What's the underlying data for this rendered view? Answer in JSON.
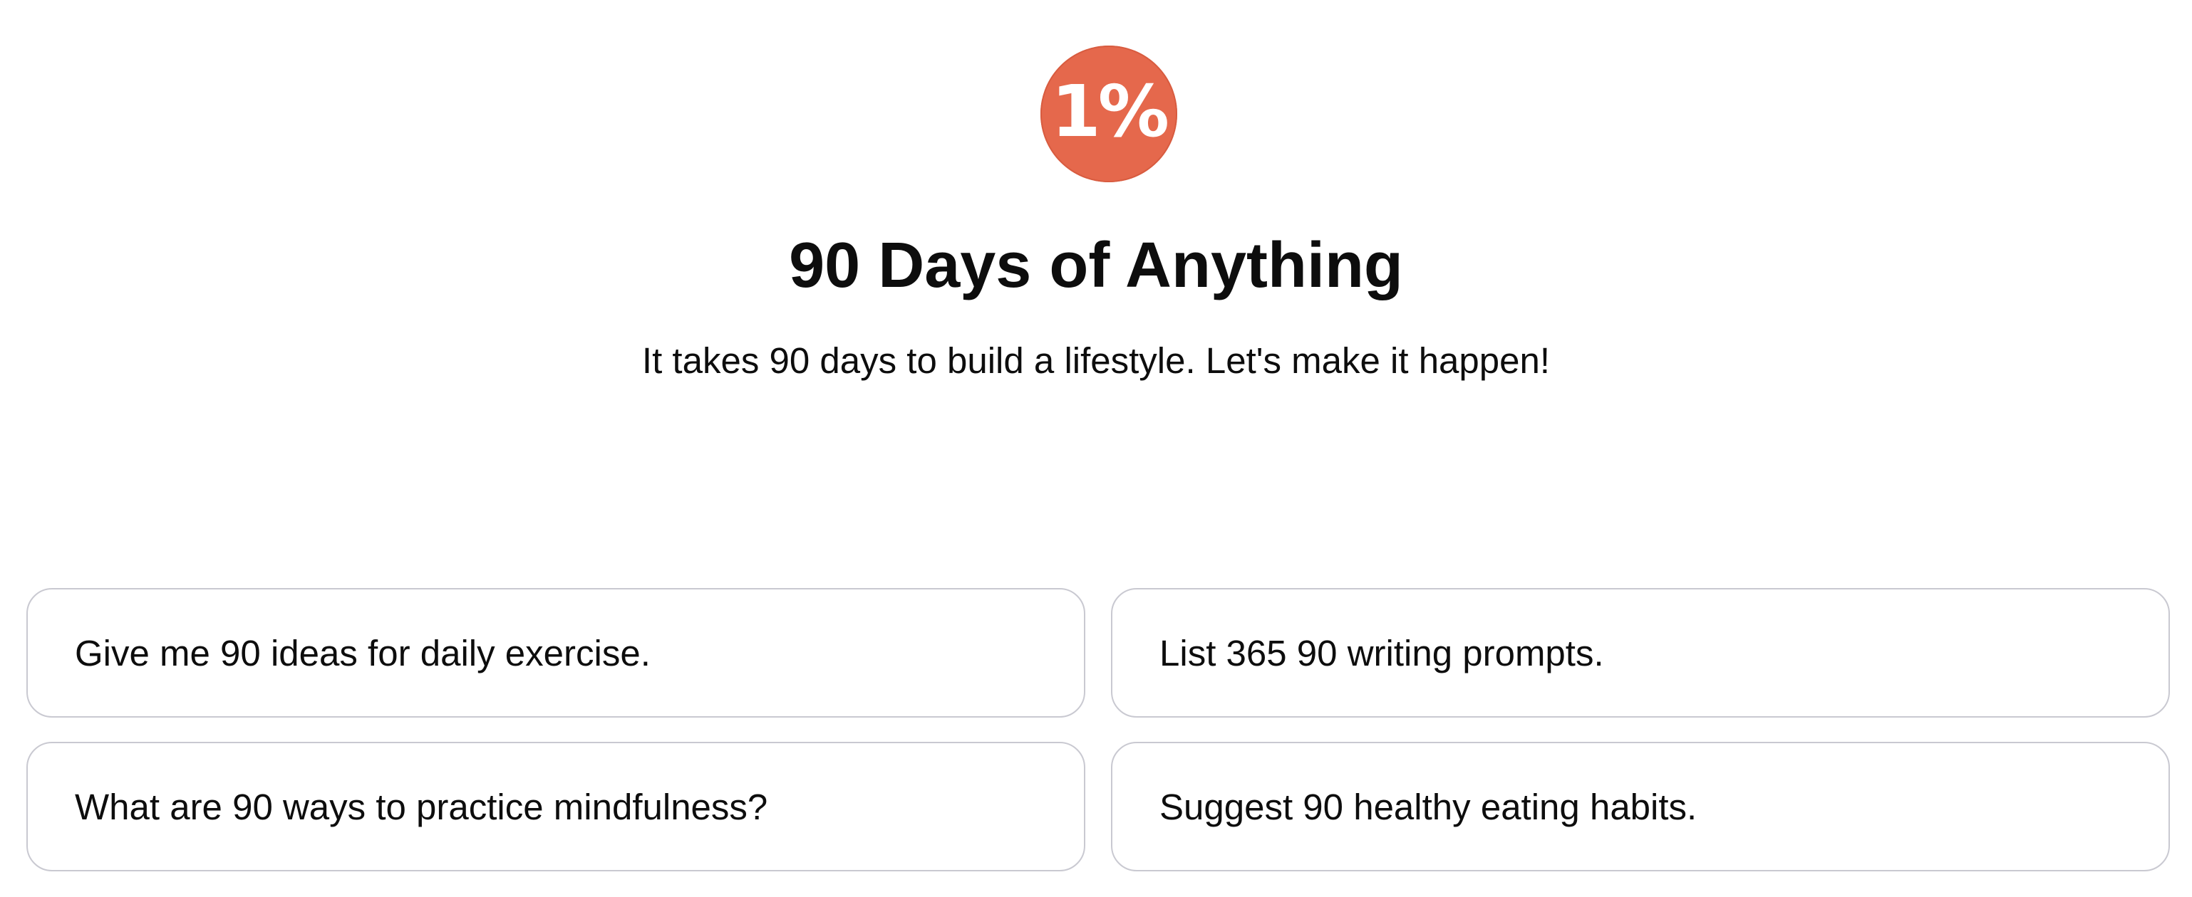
{
  "logo": {
    "text": "1%",
    "color": "#e5684c"
  },
  "title": "90 Days of Anything",
  "subtitle": "It takes 90 days to build a lifestyle. Let's make it happen!",
  "prompts": [
    {
      "label": "Give me 90 ideas for daily exercise."
    },
    {
      "label": "List 365 90 writing prompts."
    },
    {
      "label": "What are 90 ways to practice mindfulness?"
    },
    {
      "label": "Suggest 90 healthy eating habits."
    }
  ],
  "colors": {
    "card_border": "#c9c9d1",
    "text": "#0d0d0d"
  }
}
